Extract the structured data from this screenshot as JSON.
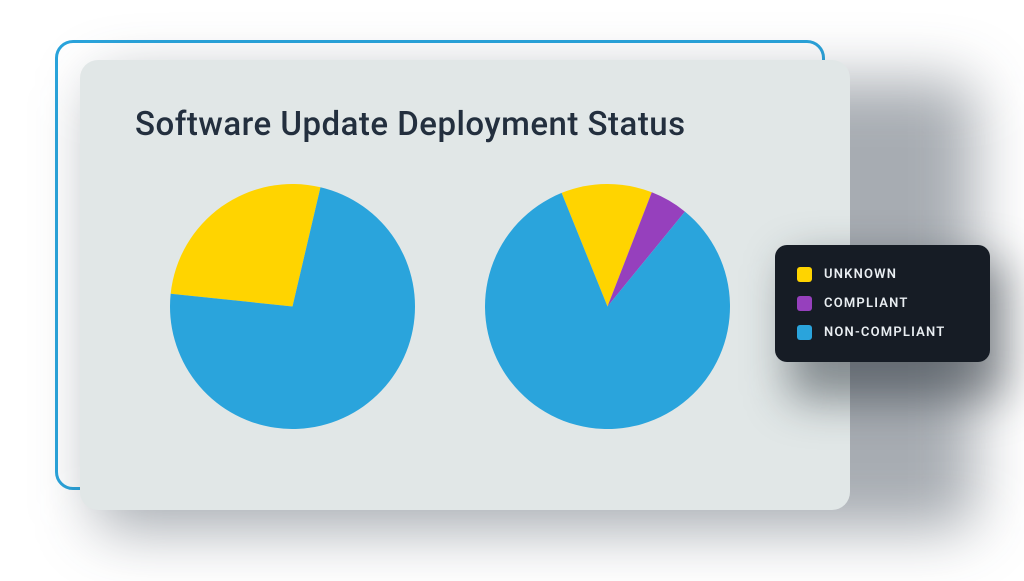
{
  "title": "Software Update Deployment Status",
  "colors": {
    "unknown": "#ffd400",
    "compliant": "#9640bd",
    "non_compliant": "#2aa4dc"
  },
  "legend": [
    {
      "key": "unknown",
      "label": "UNKNOWN"
    },
    {
      "key": "compliant",
      "label": "COMPLIANT"
    },
    {
      "key": "non_compliant",
      "label": "NON-COMPLIANT"
    }
  ],
  "chart_data": [
    {
      "type": "pie",
      "title": "",
      "series": [
        {
          "name": "UNKNOWN",
          "value": 27
        },
        {
          "name": "NON-COMPLIANT",
          "value": 73
        }
      ]
    },
    {
      "type": "pie",
      "title": "",
      "series": [
        {
          "name": "UNKNOWN",
          "value": 12
        },
        {
          "name": "COMPLIANT",
          "value": 5
        },
        {
          "name": "NON-COMPLIANT",
          "value": 83
        }
      ]
    }
  ]
}
